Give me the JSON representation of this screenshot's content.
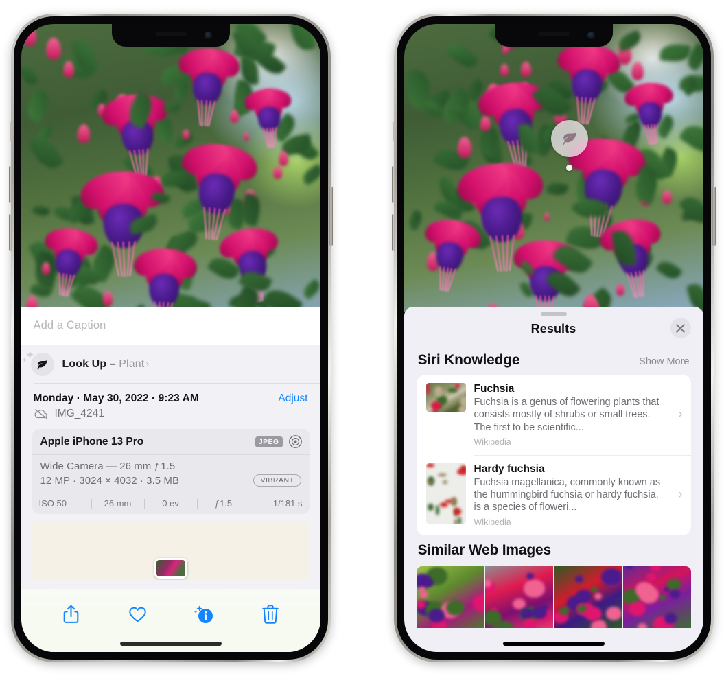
{
  "left_phone": {
    "name": "Photos app — photo info view",
    "photo": {
      "alt_name": "fuchsia-flowers-photo"
    },
    "caption": {
      "placeholder": "Add a Caption",
      "value": ""
    },
    "look_up": {
      "icon": "leaf-icon",
      "sparkle_icon": "sparkle-icon",
      "label": "Look Up – ",
      "subject": "Plant",
      "chevron": "›"
    },
    "date_row": {
      "date": "Monday · May 30, 2022 · 9:23 AM",
      "adjust_label": "Adjust"
    },
    "file_row": {
      "icon": "icloud-slash-icon",
      "filename": "IMG_4241"
    },
    "camera_card": {
      "model": "Apple iPhone 13 Pro",
      "format_tag": "JPEG",
      "aperture_icon": "aperture-icon",
      "lens_line": "Wide Camera — 26 mm ƒ 1.5",
      "specs_line": "12 MP · 3024 × 4032 · 3.5 MB",
      "style_tag": "VIBRANT",
      "exif": [
        "ISO 50",
        "26 mm",
        "0 ev",
        "ƒ1.5",
        "1/181 s"
      ]
    },
    "map": {
      "name": "location-map",
      "pin": "photo-thumbnail-pin"
    },
    "toolbar": {
      "share": "share-icon",
      "favorite": "heart-icon",
      "info": "info-sparkle-icon",
      "trash": "trash-icon"
    }
  },
  "right_phone": {
    "name": "Photos app — Visual Look Up results",
    "visual_lookup_badge": {
      "icon": "leaf-icon",
      "marker": "lookup-indicator-dot"
    },
    "sheet": {
      "grabber": "sheet-grabber",
      "title": "Results",
      "close_icon": "close-icon"
    },
    "siri_knowledge": {
      "title": "Siri Knowledge",
      "action": "Show More",
      "items": [
        {
          "title": "Fuchsia",
          "description": "Fuchsia is a genus of flowering plants that consists mostly of shrubs or small trees. The first to be scientific...",
          "source": "Wikipedia",
          "chevron": "›",
          "thumbnail": "fuchsia-red-flowers-thumbnail"
        },
        {
          "title": "Hardy fuchsia",
          "description": "Fuchsia magellanica, commonly known as the hummingbird fuchsia or hardy fuchsia, is a species of floweri...",
          "source": "Wikipedia",
          "chevron": "›",
          "thumbnail": "hardy-fuchsia-specimen-thumbnail"
        }
      ]
    },
    "similar_web_images": {
      "title": "Similar Web Images",
      "thumbnails": [
        "fuchsia-web-image-1",
        "fuchsia-web-image-2",
        "fuchsia-web-image-3",
        "fuchsia-web-image-4"
      ]
    }
  },
  "colors": {
    "accent_blue": "#1485ff",
    "sheet_bg": "#f0eff5",
    "info_bg": "#f2f2f6",
    "card_bg": "#ffffff",
    "muted_text": "#6e6e74",
    "flower_pink": "#e01a74",
    "flower_purple": "#4a1b8c",
    "foliage_green": "#4d6b3e"
  }
}
